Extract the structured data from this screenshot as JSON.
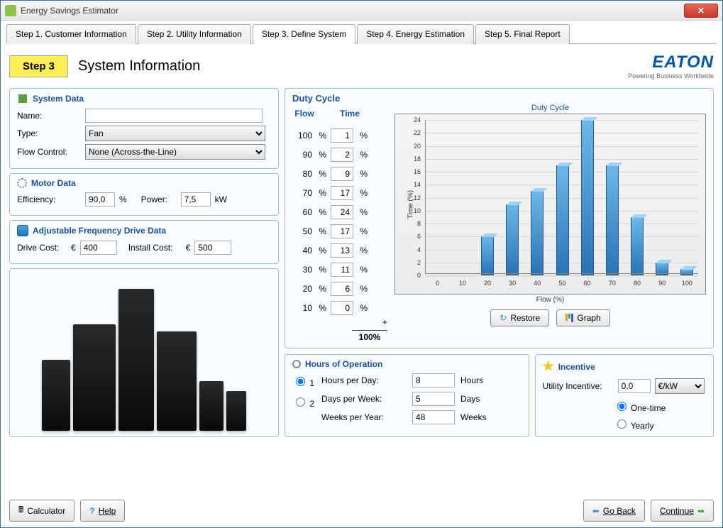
{
  "window_title": "Energy Savings Estimator",
  "tabs": [
    {
      "label": "Step 1. Customer Information"
    },
    {
      "label": "Step 2. Utility Information"
    },
    {
      "label": "Step 3. Define System"
    },
    {
      "label": "Step 4. Energy Estimation"
    },
    {
      "label": "Step 5. Final Report"
    }
  ],
  "active_tab": 2,
  "step_badge": "Step 3",
  "page_title": "System Information",
  "logo": {
    "brand": "EATON",
    "tagline": "Powering Business Worldwide"
  },
  "system_data": {
    "title": "System Data",
    "name_label": "Name:",
    "name_value": "",
    "type_label": "Type:",
    "type_value": "Fan",
    "flow_label": "Flow Control:",
    "flow_value": "None (Across-the-Line)"
  },
  "motor_data": {
    "title": "Motor Data",
    "eff_label": "Efficiency:",
    "eff_value": "90,0",
    "eff_unit": "%",
    "power_label": "Power:",
    "power_value": "7,5",
    "power_unit": "kW"
  },
  "afd": {
    "title": "Adjustable Frequency Drive Data",
    "drive_label": "Drive Cost:",
    "drive_cur": "€",
    "drive_value": "400",
    "install_label": "Install Cost:",
    "install_cur": "€",
    "install_value": "500"
  },
  "duty": {
    "title": "Duty Cycle",
    "flow_head": "Flow",
    "time_head": "Time",
    "pct": "%",
    "rows": [
      {
        "flow": "100",
        "time": "1"
      },
      {
        "flow": "90",
        "time": "2"
      },
      {
        "flow": "80",
        "time": "9"
      },
      {
        "flow": "70",
        "time": "17"
      },
      {
        "flow": "60",
        "time": "24"
      },
      {
        "flow": "50",
        "time": "17"
      },
      {
        "flow": "40",
        "time": "13"
      },
      {
        "flow": "30",
        "time": "11"
      },
      {
        "flow": "20",
        "time": "6"
      },
      {
        "flow": "10",
        "time": "0"
      }
    ],
    "plus": "+",
    "total": "100%"
  },
  "chart_data": {
    "type": "bar",
    "title": "Duty Cycle",
    "xlabel": "Flow (%)",
    "ylabel": "Time (%)",
    "categories": [
      "0",
      "10",
      "20",
      "30",
      "40",
      "50",
      "60",
      "70",
      "80",
      "90",
      "100"
    ],
    "values": [
      0,
      0,
      6,
      11,
      13,
      17,
      24,
      17,
      9,
      2,
      1
    ],
    "ylim": [
      0,
      24
    ],
    "yticks": [
      0,
      2,
      4,
      6,
      8,
      10,
      12,
      14,
      16,
      18,
      20,
      22,
      24
    ]
  },
  "chart_buttons": {
    "restore": "Restore",
    "graph": "Graph"
  },
  "hours": {
    "title": "Hours of Operation",
    "opt1": "1",
    "opt2": "2",
    "opt_selected": "1",
    "hpd_label": "Hours per Day:",
    "hpd_value": "8",
    "hpd_unit": "Hours",
    "dpw_label": "Days per Week:",
    "dpw_value": "5",
    "dpw_unit": "Days",
    "wpy_label": "Weeks per Year:",
    "wpy_value": "48",
    "wpy_unit": "Weeks"
  },
  "incentive": {
    "title": "Incentive",
    "util_label": "Utility Incentive:",
    "util_value": "0,0",
    "util_unit": "€/kW",
    "one_time": "One-time",
    "yearly": "Yearly",
    "selected": "one"
  },
  "footer": {
    "calc": "Calculator",
    "help": "Help",
    "back": "Go Back",
    "cont": "Continue"
  }
}
